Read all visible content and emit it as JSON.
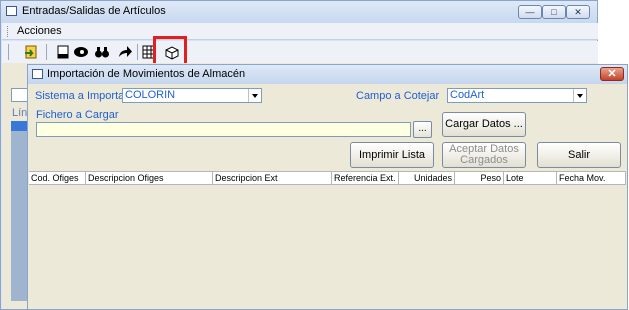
{
  "main_window": {
    "title": "Entradas/Salidas de Artículos",
    "controls": {
      "minimize": "—",
      "maximize": "□",
      "close": "✕"
    },
    "menu": {
      "acciones": "Acciones"
    },
    "partial_label": "Lín",
    "toolbar_icons": [
      "import-icon",
      "new-doc-icon",
      "eye-icon",
      "binoculars-icon",
      "forward-arrow-icon",
      "grid-icon",
      "box-icon"
    ]
  },
  "dialog": {
    "title": "Importación de Movimientos de Almacén",
    "close": "✕",
    "sistema_label": "Sistema a Importar",
    "sistema_value": "COLORIN",
    "campo_label": "Campo a Cotejar",
    "campo_value": "CodArt",
    "fichero_label": "Fichero a Cargar",
    "fichero_value": "",
    "browse_label": "...",
    "cargar_label": "Cargar Datos ...",
    "imprimir_label": "Imprimir Lista",
    "aceptar_label_1": "Aceptar Datos",
    "aceptar_label_2": "Cargados",
    "salir_label": "Salir",
    "columns": [
      "Cod. Ofiges",
      "Descripcion Ofiges",
      "Descripcion Ext",
      "Referencia Ext.",
      "Unidades",
      "Peso",
      "Lote",
      "Fecha Mov."
    ]
  },
  "colors": {
    "accent_label": "#1f5fd4",
    "highlight_border": "#e02020"
  }
}
